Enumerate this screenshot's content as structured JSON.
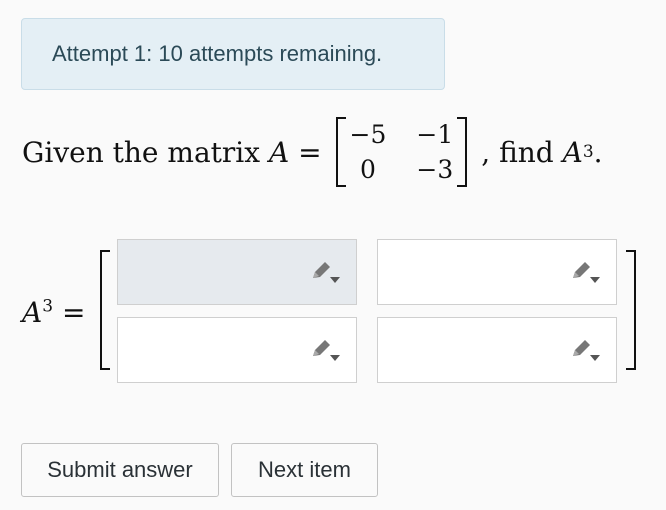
{
  "attempt_banner": "Attempt 1: 10 attempts remaining.",
  "question": {
    "prefix": "Given the matrix",
    "var": "A",
    "eq": "=",
    "matrix": [
      "−5",
      "−1",
      "0",
      "−3"
    ],
    "suffix_text": ", find",
    "target_var": "A",
    "target_exp": "3",
    "period": "."
  },
  "answer": {
    "lhs_var": "A",
    "lhs_exp": "3",
    "eq": "=",
    "cells": [
      "",
      "",
      "",
      ""
    ]
  },
  "icons": {
    "edit": "pencil-dropdown-icon"
  },
  "buttons": {
    "submit": "Submit answer",
    "next": "Next item"
  }
}
